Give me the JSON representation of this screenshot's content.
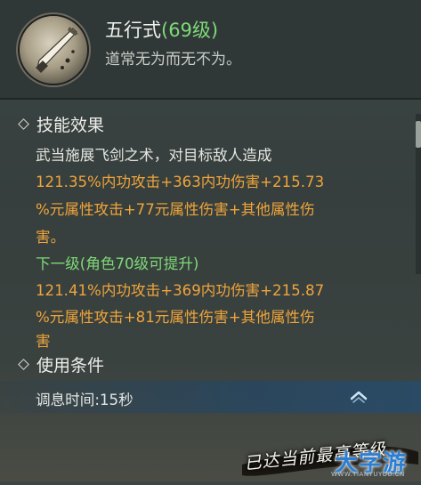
{
  "skill": {
    "name": "五行式",
    "level": "(69级)",
    "description": "道常无为而无不为。"
  },
  "sections": {
    "effect_title": "技能效果",
    "effect_lines": [
      "武当施展飞剑之术，对目标敌人造成",
      "121.35%内功攻击+363内功伤害+215.73",
      "%元属性攻击+77元属性伤害+其他属性伤",
      "害。"
    ],
    "next_level_title": "下一级(角色70级可提升)",
    "next_level_lines": [
      "121.41%内功攻击+369内功伤害+215.87",
      "%元属性攻击+81元属性伤害+其他属性伤",
      "害"
    ],
    "usage_title": "使用条件",
    "cooldown": "调息时间:15秒"
  },
  "watermark": {
    "caption": "已达当前最高等级",
    "logo": "大字游",
    "logo_url_text": "WWW.TIANYUYOU.CN"
  },
  "icons": {
    "skill": "sword-icon",
    "scroll_up": "chevron-up-icon"
  }
}
